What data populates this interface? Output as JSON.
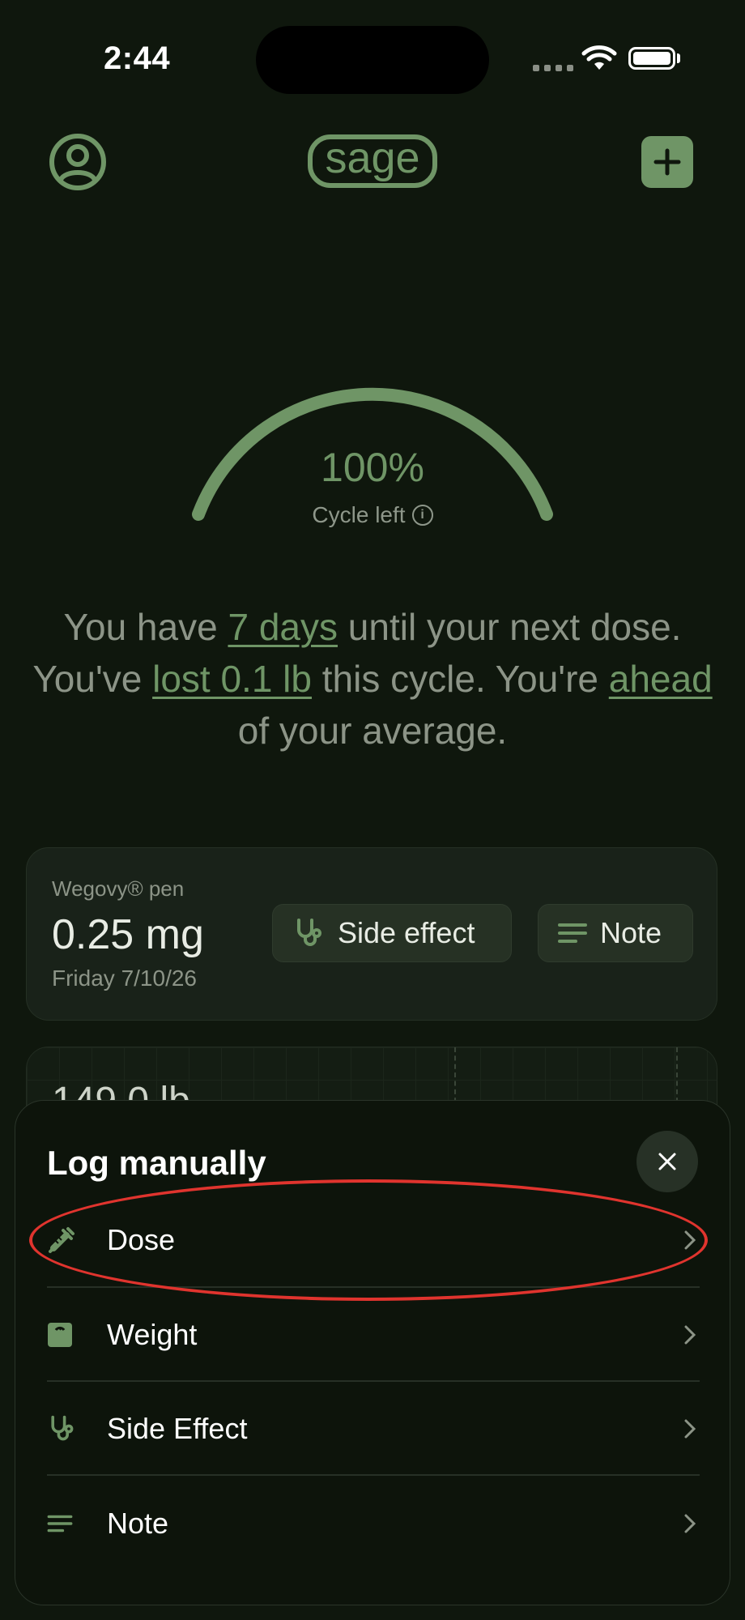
{
  "status_bar": {
    "time": "2:44"
  },
  "header": {
    "logo_text": "sage"
  },
  "gauge": {
    "percent_label": "100%",
    "caption": "Cycle left",
    "level_fraction": 1.0
  },
  "summary": {
    "part1": "You have ",
    "days": "7 days",
    "part2": " until your next dose. You've ",
    "lost": "lost 0.1 lb",
    "part3": " this cycle. You're ",
    "ahead": "ahead",
    "part4": " of your average."
  },
  "dose_card": {
    "medication": "Wegovy® pen",
    "dose": "0.25 mg",
    "date": "Friday 7/10/26",
    "side_effect_label": "Side effect",
    "note_label": "Note"
  },
  "weight_card": {
    "value": "149.0 lb"
  },
  "sheet": {
    "title": "Log manually",
    "items": [
      {
        "label": "Dose",
        "icon": "syringe-icon"
      },
      {
        "label": "Weight",
        "icon": "scale-icon"
      },
      {
        "label": "Side Effect",
        "icon": "stethoscope-icon"
      },
      {
        "label": "Note",
        "icon": "note-lines-icon"
      }
    ]
  },
  "colors": {
    "background": "#0f170d",
    "accent": "#6f9566",
    "muted_text": "#8c9487",
    "highlight": "#e0342e"
  }
}
